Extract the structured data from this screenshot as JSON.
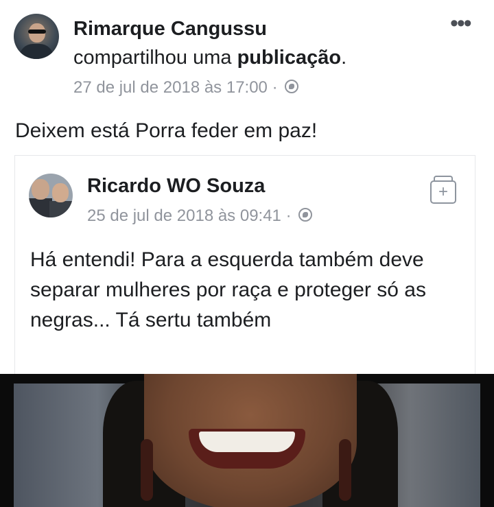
{
  "post": {
    "author": "Rimarque Cangussu",
    "shared_prefix": "compartilhou uma ",
    "shared_object": "publicação",
    "shared_suffix": ".",
    "timestamp": "27 de jul de 2018 às 17:00 ·",
    "privacy_icon": "globe-icon",
    "more_icon": "•••",
    "text": "Deixem está Porra feder em paz!"
  },
  "shared_post": {
    "author": "Ricardo WO Souza",
    "timestamp": "25 de jul de 2018 às 09:41 ·",
    "privacy_icon": "globe-icon",
    "save_icon": "+",
    "text": "Há entendi! Para a esquerda também deve separar mulheres por raça e proteger só as negras... Tá sertu também"
  },
  "colors": {
    "text": "#1c1e21",
    "meta": "#90949c",
    "border": "#e6e7ea"
  }
}
